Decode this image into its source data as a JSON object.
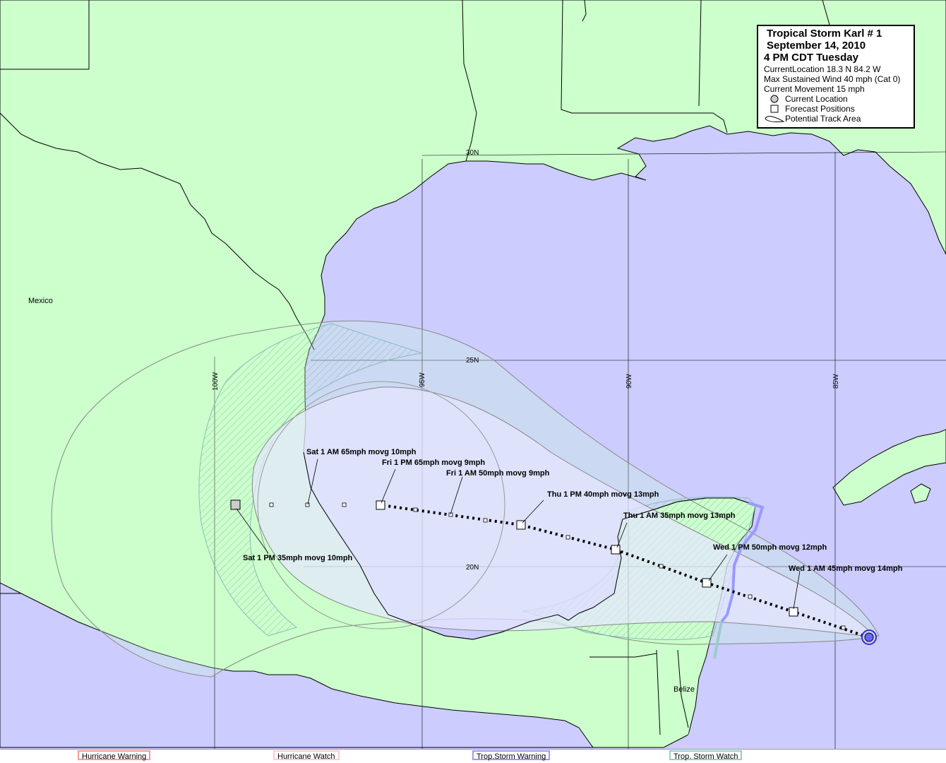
{
  "legend": {
    "title": "Tropical Storm Karl # 1",
    "date": "September 14, 2010",
    "time": "4 PM CDT Tuesday",
    "current_location": "CurrentLocation 18.3 N  84.2 W",
    "max_wind": "Max Sustained Wind 40 mph (Cat 0)",
    "movement": "Current Movement 15 mph",
    "key_current": "Current Location",
    "key_forecast": "Forecast Positions",
    "key_track": "Potential Track Area"
  },
  "grid": {
    "lon_labels": [
      "100W",
      "95W",
      "90W",
      "85W"
    ],
    "lat_labels": [
      "30N",
      "25N",
      "20N"
    ]
  },
  "places": {
    "mexico": "Mexico",
    "belize": "Belize"
  },
  "forecasts": [
    {
      "label": "Wed 1 AM 45mph movg 14mph"
    },
    {
      "label": "Wed 1 PM 50mph movg 12mph"
    },
    {
      "label": "Thu 1 AM 35mph movg 13mph"
    },
    {
      "label": "Thu 1 PM 40mph movg 13mph"
    },
    {
      "label": "Fri 1 AM 50mph movg 9mph"
    },
    {
      "label": "Fri 1 PM 65mph movg 9mph"
    },
    {
      "label": "Sat 1 AM 65mph movg 10mph"
    },
    {
      "label": "Sat 1 PM 35mph movg 10mph"
    }
  ],
  "warnings": {
    "hurricane_warning": "Hurricane Warning",
    "hurricane_watch": "Hurricane  Watch",
    "ts_warning": "Trop.Storm Warning",
    "ts_watch": "Trop. Storm Watch"
  },
  "colors": {
    "land": "#ccffcc",
    "water": "#ccccff",
    "hurricane_warning": "#ff9999",
    "hurricane_watch": "#ffcccc",
    "ts_warning": "#9999ff",
    "ts_watch": "#99cccc"
  }
}
